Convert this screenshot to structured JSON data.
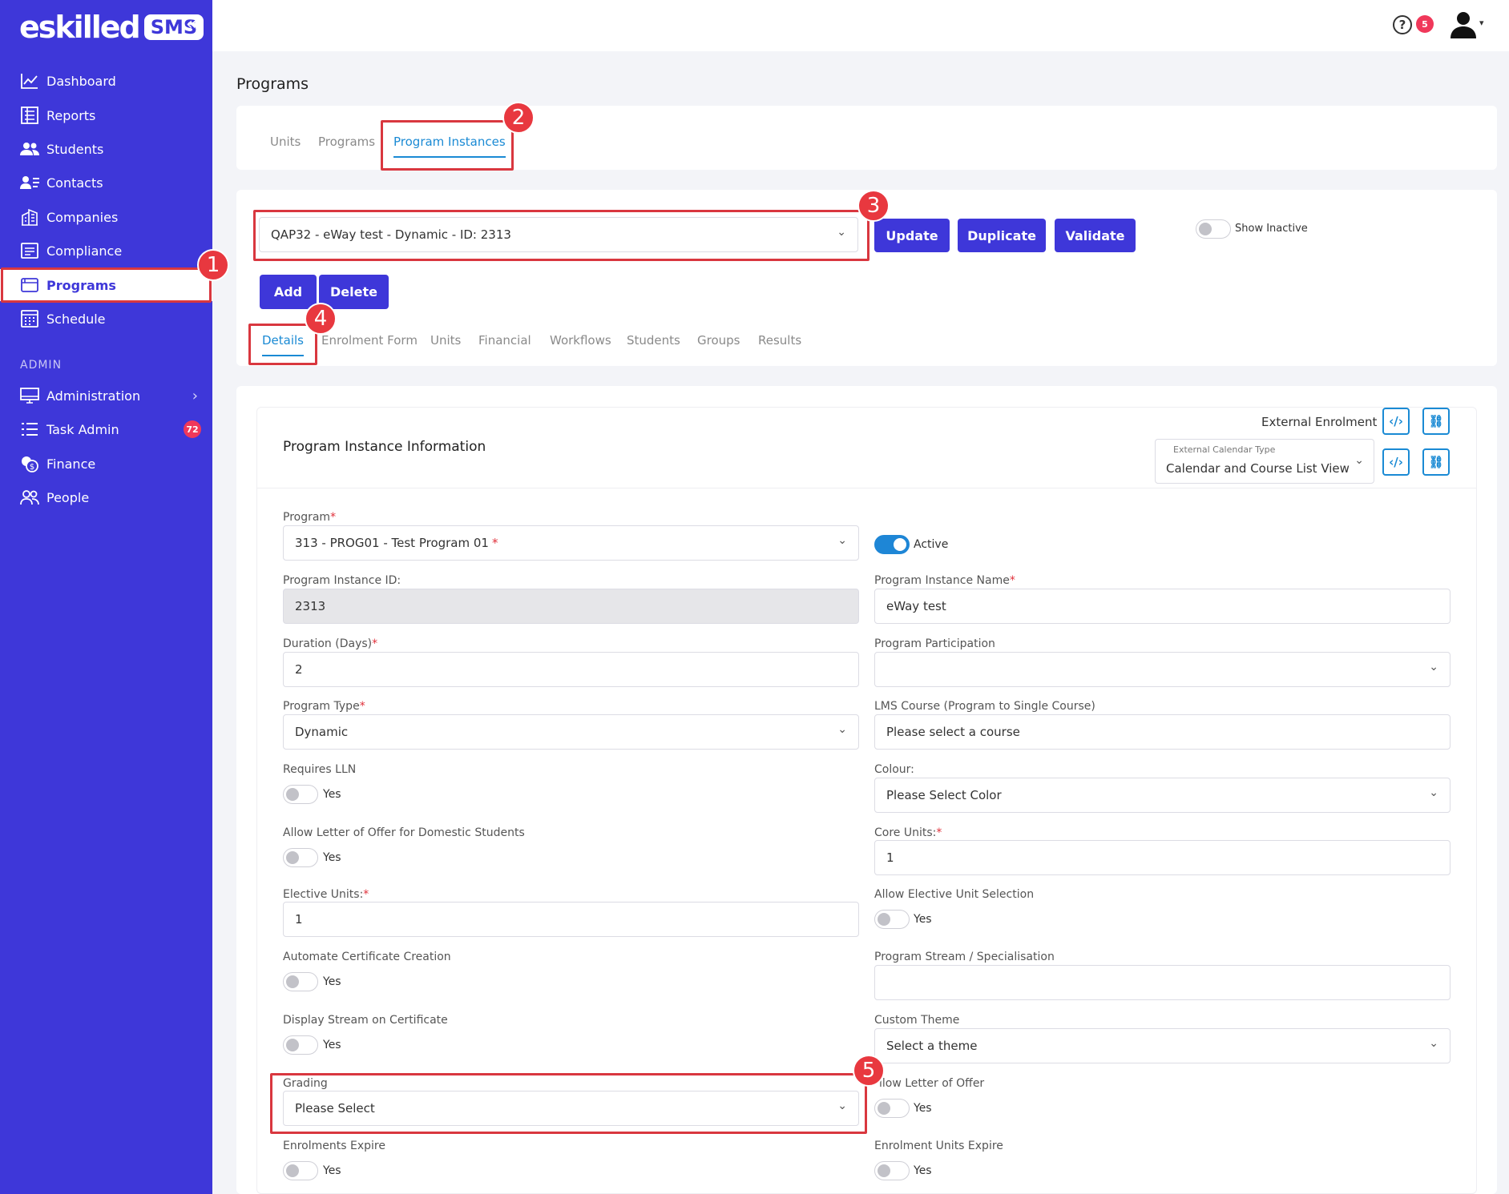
{
  "app": {
    "logo_text": "eskilled",
    "logo_badge": "SMS",
    "collapse_icon": "double-chevron-left-icon"
  },
  "sidebar": {
    "items": [
      {
        "label": "Dashboard",
        "icon": "chart-line-icon"
      },
      {
        "label": "Reports",
        "icon": "report-icon"
      },
      {
        "label": "Students",
        "icon": "students-icon"
      },
      {
        "label": "Contacts",
        "icon": "contacts-icon"
      },
      {
        "label": "Companies",
        "icon": "building-icon"
      },
      {
        "label": "Compliance",
        "icon": "compliance-icon"
      },
      {
        "label": "Programs",
        "icon": "programs-icon"
      },
      {
        "label": "Schedule",
        "icon": "calendar-icon"
      }
    ],
    "admin_section": "ADMIN",
    "admin_items": [
      {
        "label": "Administration",
        "icon": "monitor-icon"
      },
      {
        "label": "Task Admin",
        "icon": "tasks-icon",
        "badge": "72"
      },
      {
        "label": "Finance",
        "icon": "coins-icon"
      },
      {
        "label": "People",
        "icon": "people-icon"
      }
    ]
  },
  "topbar": {
    "help_badge": "5",
    "help_symbol": "?",
    "caret": "▾"
  },
  "page": {
    "title": "Programs"
  },
  "top_tabs": [
    "Units",
    "Programs",
    "Program Instances"
  ],
  "instance_select": {
    "value": "QAP32 - eWay test - Dynamic - ID: 2313"
  },
  "actions": {
    "update": "Update",
    "duplicate": "Duplicate",
    "validate": "Validate",
    "show_inactive": "Show Inactive",
    "add": "Add",
    "delete": "Delete"
  },
  "sub_tabs": [
    "Details",
    "Enrolment Form",
    "Units",
    "Financial",
    "Workflows",
    "Students",
    "Groups",
    "Results"
  ],
  "info": {
    "title": "Program Instance Information",
    "external_enrolment": "External Enrolment",
    "ext_cal_label": "External Calendar Type",
    "ext_cal_value": "Calendar and Course List View",
    "code_symbol": "‹/›",
    "link_symbol": "⛓"
  },
  "form": {
    "program_label": "Program",
    "program_value": "313 - PROG01 - Test Program 01",
    "active_label": "Active",
    "instance_id_label": "Program Instance ID:",
    "instance_id_value": "2313",
    "instance_name_label": "Program Instance Name",
    "instance_name_value": "eWay test",
    "duration_label": "Duration (Days)",
    "duration_value": "2",
    "participation_label": "Program Participation",
    "participation_value": "",
    "type_label": "Program Type",
    "type_value": "Dynamic",
    "lms_label": "LMS Course (Program to Single Course)",
    "lms_value": "Please select a course",
    "lln_label": "Requires LLN",
    "colour_label": "Colour:",
    "colour_value": "Please Select Color",
    "letter_domestic_label": "Allow Letter of Offer for Domestic Students",
    "core_units_label": "Core Units:",
    "core_units_value": "1",
    "elective_units_label": "Elective Units:",
    "elective_units_value": "1",
    "allow_elective_label": "Allow Elective Unit Selection",
    "auto_cert_label": "Automate Certificate Creation",
    "stream_label": "Program Stream / Specialisation",
    "stream_value": "",
    "display_stream_label": "Display Stream on Certificate",
    "theme_label": "Custom Theme",
    "theme_value": "Select a theme",
    "grading_label": "Grading",
    "grading_value": "Please Select",
    "letter_offer_label": "llow Letter of Offer",
    "enrol_expire_label": "Enrolments Expire",
    "enrol_units_expire_label": "Enrolment Units Expire",
    "yes": "Yes",
    "required_mark": "*"
  },
  "annotations": [
    "1",
    "2",
    "3",
    "4",
    "5"
  ],
  "colors": {
    "sidebar": "#3e37d9",
    "accent": "#1a8ad4",
    "annotation": "#d9373f",
    "badge": "#f0385a"
  }
}
